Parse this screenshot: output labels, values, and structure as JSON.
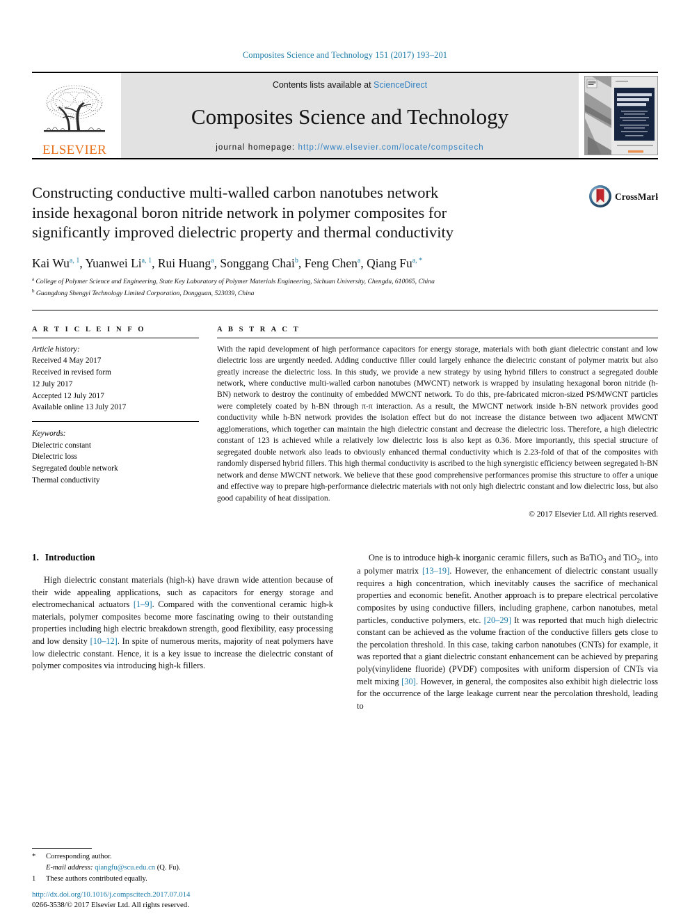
{
  "running_head": "Composites Science and Technology 151 (2017) 193–201",
  "masthead": {
    "publisher_wordmark": "ELSEVIER",
    "contents_prefix": "Contents lists available at ",
    "sciencedirect": "ScienceDirect",
    "journal_title": "Composites Science and Technology",
    "homepage_label": "journal homepage: ",
    "homepage_url": "http://www.elsevier.com/locate/compscitech",
    "cover_title_line1": "COMPOSITES",
    "cover_title_line2": "SCIENCE AND",
    "cover_title_line3": "TECHNOLOGY",
    "cover_publisher": "ELSEVIER",
    "link_color": "#2f7fc1",
    "banner_bg": "#e2e2e2",
    "elsevier_orange": "#e9711c"
  },
  "article": {
    "title_line1": "Constructing conductive multi-walled carbon nanotubes network",
    "title_line2": "inside hexagonal boron nitride network in polymer composites for",
    "title_line3": "significantly improved dielectric property and thermal conductivity",
    "crossmark_label": "CrossMark",
    "authors": [
      {
        "name": "Kai Wu",
        "sup": "a, 1",
        "sep": ", "
      },
      {
        "name": "Yuanwei Li",
        "sup": "a, 1",
        "sep": ", "
      },
      {
        "name": "Rui Huang",
        "sup": "a",
        "sep": ", "
      },
      {
        "name": "Songgang Chai",
        "sup": "b",
        "sep": ", "
      },
      {
        "name": "Feng Chen",
        "sup": "a",
        "sep": ", "
      },
      {
        "name": "Qiang Fu",
        "sup": "a, *",
        "sep": ""
      }
    ],
    "affiliations": [
      {
        "mark": "a",
        "text": "College of Polymer Science and Engineering, State Key Laboratory of Polymer Materials Engineering, Sichuan University, Chengdu, 610065, China"
      },
      {
        "mark": "b",
        "text": "Guangdong Shengyi Technology Limited Corporation, Dongguan, 523039, China"
      }
    ]
  },
  "article_info": {
    "heading": "A R T I C L E   I N F O",
    "history_label": "Article history:",
    "history_lines": [
      "Received 4 May 2017",
      "Received in revised form",
      "12 July 2017",
      "Accepted 12 July 2017",
      "Available online 13 July 2017"
    ],
    "keywords_label": "Keywords:",
    "keywords": [
      "Dielectric constant",
      "Dielectric loss",
      "Segregated double network",
      "Thermal conductivity"
    ]
  },
  "abstract": {
    "heading": "A B S T R A C T",
    "text": "With the rapid development of high performance capacitors for energy storage, materials with both giant dielectric constant and low dielectric loss are urgently needed. Adding conductive filler could largely enhance the dielectric constant of polymer matrix but also greatly increase the dielectric loss. In this study, we provide a new strategy by using hybrid fillers to construct a segregated double network, where conductive multi-walled carbon nanotubes (MWCNT) network is wrapped by insulating hexagonal boron nitride (h-BN) network to destroy the continuity of embedded MWCNT network. To do this, pre-fabricated micron-sized PS/MWCNT particles were completely coated by h-BN through π-π interaction. As a result, the MWCNT network inside h-BN network provides good conductivity while h-BN network provides the isolation effect but do not increase the distance between two adjacent MWCNT agglomerations, which together can maintain the high dielectric constant and decrease the dielectric loss. Therefore, a high dielectric constant of 123 is achieved while a relatively low dielectric loss is also kept as 0.36. More importantly, this special structure of segregated double network also leads to obviously enhanced thermal conductivity which is 2.23-fold of that of the composites with randomly dispersed hybrid fillers. This high thermal conductivity is ascribed to the high synergistic efficiency between segregated h-BN network and dense MWCNT network. We believe that these good comprehensive performances promise this structure to offer a unique and effective way to prepare high-performance dielectric materials with not only high dielectric constant and low dielectric loss, but also good capability of heat dissipation.",
    "copyright": "© 2017 Elsevier Ltd. All rights reserved."
  },
  "introduction": {
    "number": "1.",
    "heading": "Introduction",
    "left_paragraph_pre": "High dielectric constant materials (high-k) have drawn wide attention because of their wide appealing applications, such as capacitors for energy storage and electromechanical actuators ",
    "left_cite_1": "[1–9]",
    "left_paragraph_mid": ". Compared with the conventional ceramic high-k materials, polymer composites become more fascinating owing to their outstanding properties including high electric breakdown strength, good flexibility, easy processing and low density ",
    "left_cite_2": "[10–12]",
    "left_paragraph_post": ". In spite of numerous merits, majority of neat polymers have low dielectric constant. Hence, it is a key issue to increase the dielectric constant of polymer composites via introducing high-k fillers.",
    "right_pre": "One is to introduce high-k inorganic ceramic fillers, such as BaTiO",
    "right_sub_1": "3",
    "right_mid_1": " and TiO",
    "right_sub_2": "2",
    "right_mid_2": ", into a polymer matrix ",
    "right_cite_1": "[13–19]",
    "right_mid_3": ". However, the enhancement of dielectric constant usually requires a high concentration, which inevitably causes the sacrifice of mechanical properties and economic benefit. Another approach is to prepare electrical percolative composites by using conductive fillers, including graphene, carbon nanotubes, metal particles, conductive polymers, etc. ",
    "right_cite_2": "[20–29]",
    "right_mid_4": " It was reported that much high dielectric constant can be achieved as the volume fraction of the conductive fillers gets close to the percolation threshold. In this case, taking carbon nanotubes (CNTs) for example, it was reported that a giant dielectric constant enhancement can be achieved by preparing poly(vinylidene fluoride) (PVDF) composites with uniform dispersion of CNTs via melt mixing ",
    "right_cite_3": "[30]",
    "right_post": ". However, in general, the composites also exhibit high dielectric loss for the occurrence of the large leakage current near the percolation threshold, leading to"
  },
  "footnotes": {
    "corresponding_mark": "*",
    "corresponding_text": "Corresponding author.",
    "email_label": "E-mail address:",
    "email_value": "qiangfu@scu.edu.cn",
    "email_suffix": "(Q. Fu).",
    "equal_mark": "1",
    "equal_text": "These authors contributed equally."
  },
  "footer": {
    "doi": "http://dx.doi.org/10.1016/j.compscitech.2017.07.014",
    "issn_line": "0266-3538/© 2017 Elsevier Ltd. All rights reserved."
  }
}
